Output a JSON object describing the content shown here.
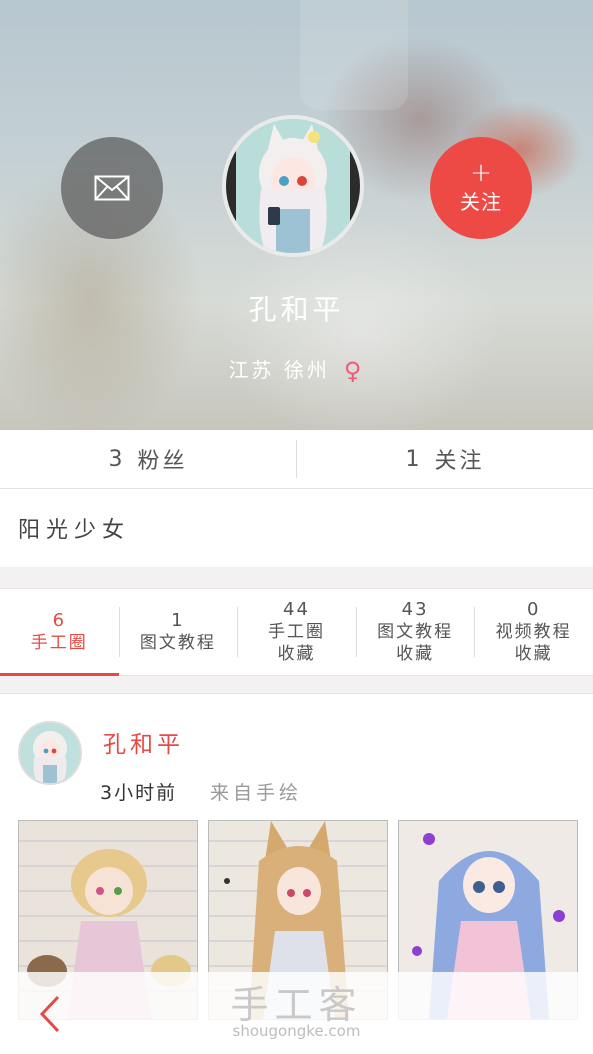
{
  "profile": {
    "name": "孔和平",
    "location": "江苏 徐州",
    "gender_symbol": "♀",
    "follow_label": "关注",
    "follow_plus": "+",
    "bio": "阳光少女"
  },
  "icons": {
    "mail": "envelope-icon",
    "back": "chevron-left-icon",
    "gender": "female-icon"
  },
  "stats": [
    {
      "num": "3",
      "label": "粉丝"
    },
    {
      "num": "1",
      "label": "关注"
    }
  ],
  "tabs": [
    {
      "count": "6",
      "label": "手工圈",
      "label2": ""
    },
    {
      "count": "1",
      "label": "图文教程",
      "label2": ""
    },
    {
      "count": "44",
      "label": "手工圈",
      "label2": "收藏"
    },
    {
      "count": "43",
      "label": "图文教程",
      "label2": "收藏"
    },
    {
      "count": "0",
      "label": "视频教程",
      "label2": "收藏"
    }
  ],
  "post": {
    "author": "孔和平",
    "time": "3小时前",
    "source": "来自手绘"
  },
  "watermark": {
    "title": "手工客",
    "url": "shougongke.com"
  },
  "colors": {
    "accent": "#e54b45",
    "follow_button": "#ee4a45",
    "gender": "#f25b77"
  }
}
